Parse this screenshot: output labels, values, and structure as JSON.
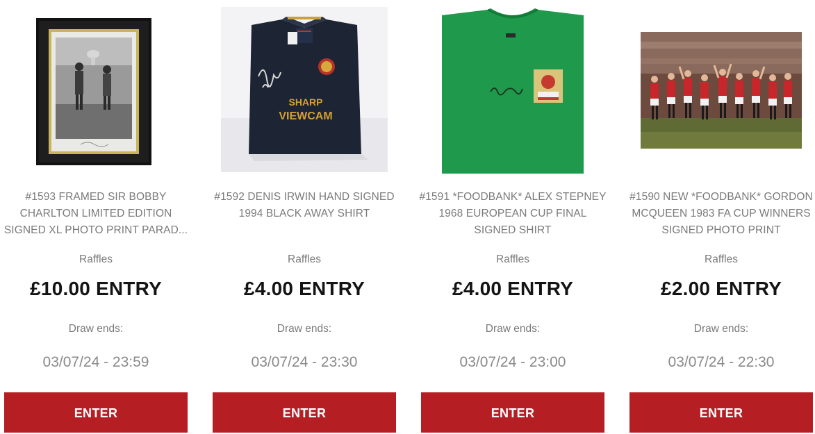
{
  "colors": {
    "button_bg": "#b51f24",
    "button_text": "#ffffff",
    "price_text": "#141414",
    "muted_text": "#7a7a7a"
  },
  "cards": [
    {
      "title": "#1593 FRAMED SIR BOBBY CHARLTON LIMITED EDITION SIGNED XL PHOTO PRINT PARAD...",
      "category": "Raffles",
      "price": "£10.00 ENTRY",
      "draw_label": "Draw ends:",
      "draw_date": "03/07/24 - 23:59",
      "button_label": "ENTER",
      "image": "framed-photo-print"
    },
    {
      "title": "#1592 DENIS IRWIN HAND SIGNED 1994 BLACK AWAY SHIRT",
      "category": "Raffles",
      "price": "£4.00 ENTRY",
      "draw_label": "Draw ends:",
      "draw_date": "03/07/24 - 23:30",
      "button_label": "ENTER",
      "image": "black-signed-shirt",
      "shirt_text_1": "SHARP",
      "shirt_text_2": "VIEWCAM"
    },
    {
      "title": "#1591 *FOODBANK* ALEX STEPNEY 1968 EUROPEAN CUP FINAL SIGNED SHIRT",
      "category": "Raffles",
      "price": "£4.00 ENTRY",
      "draw_label": "Draw ends:",
      "draw_date": "03/07/24 - 23:00",
      "button_label": "ENTER",
      "image": "green-signed-shirt"
    },
    {
      "title": "#1590 NEW *FOODBANK* GORDON MCQUEEN 1983 FA CUP WINNERS SIGNED PHOTO PRINT",
      "category": "Raffles",
      "price": "£2.00 ENTRY",
      "draw_label": "Draw ends:",
      "draw_date": "03/07/24 - 22:30",
      "button_label": "ENTER",
      "image": "team-celebration-photo"
    }
  ]
}
